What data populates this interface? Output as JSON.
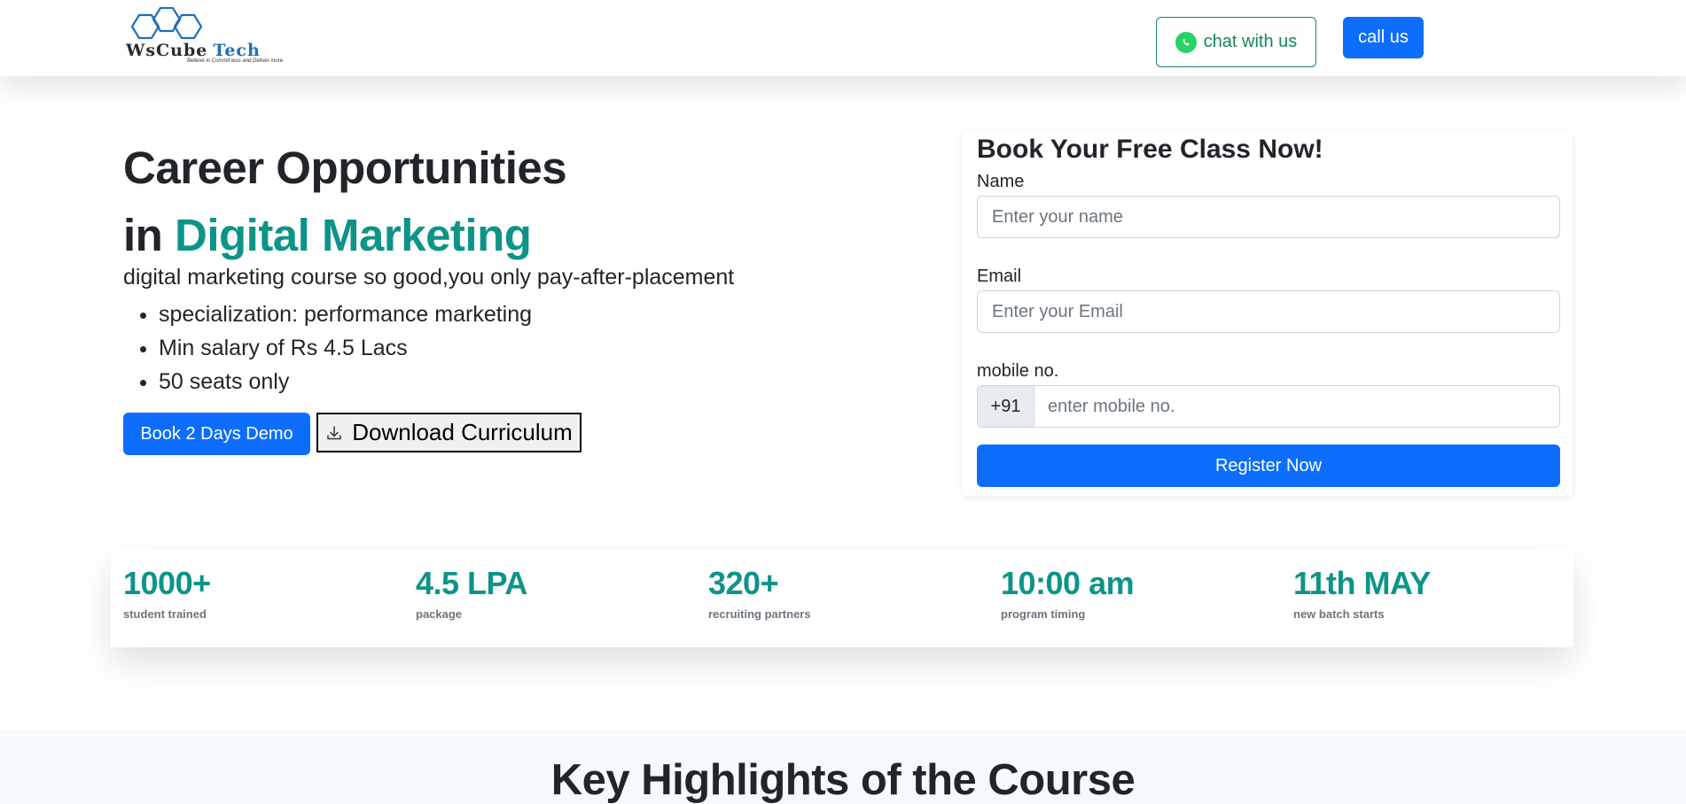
{
  "header": {
    "logo": {
      "brand_ws": "WsCube",
      "brand_tech": "Tech",
      "tagline": "Believe in Commit less and Deliver more"
    },
    "chat_label": "chat with us",
    "call_label": "call us"
  },
  "hero": {
    "title_line1": "Career Opportunities",
    "title_prefix": "in",
    "title_accent": "Digital Marketing",
    "description": "digital marketing course so good,you only pay-after-placement",
    "bullets": [
      "specialization: performance marketing",
      "Min salary of Rs 4.5 Lacs",
      "50 seats only"
    ],
    "demo_button": "Book 2 Days Demo",
    "download_button": "Download Curriculum"
  },
  "form": {
    "title": "Book Your Free Class Now!",
    "name_label": "Name",
    "name_placeholder": "Enter your name",
    "email_label": "Email",
    "email_placeholder": "Enter your Email",
    "mobile_label": "mobile no.",
    "mobile_prefix": "+91",
    "mobile_placeholder": "enter mobile no.",
    "submit_label": "Register Now"
  },
  "stats": [
    {
      "value": "1000+",
      "label": "student trained"
    },
    {
      "value": "4.5 LPA",
      "label": "package"
    },
    {
      "value": "320+",
      "label": "recruiting partners"
    },
    {
      "value": "10:00 am",
      "label": "program timing"
    },
    {
      "value": "11th MAY",
      "label": "new batch starts"
    }
  ],
  "highlights": {
    "title": "Key Highlights of the Course"
  },
  "colors": {
    "primary": "#0d6efd",
    "accent": "#0d9488",
    "whatsapp": "#25d366",
    "success": "#198754"
  },
  "icons": {
    "chat": "whatsapp-icon",
    "download": "download-icon",
    "logo": "hexagon-logo-icon"
  }
}
